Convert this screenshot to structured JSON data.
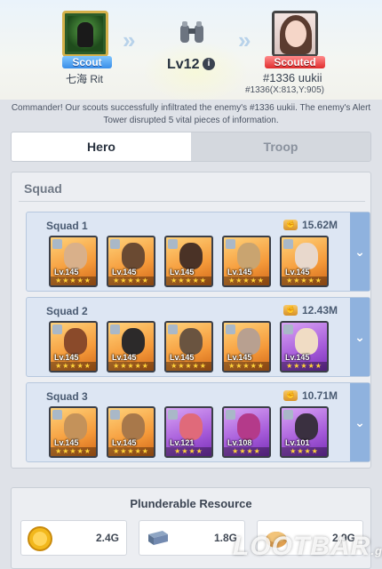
{
  "header": {
    "scout": {
      "role": "Scout",
      "name": "七海 Rit"
    },
    "level": "Lv12",
    "info_glyph": "i",
    "target": {
      "role": "Scouted",
      "name": "#1336 uukii",
      "coords": "#1336(X:813,Y:905)"
    }
  },
  "message": "Commander! Our scouts successfully infiltrated the enemy's #1336 uukii. The enemy's Alert Tower disrupted 5 vital pieces of information.",
  "tabs": [
    {
      "label": "Hero",
      "active": true
    },
    {
      "label": "Troop",
      "active": false
    }
  ],
  "squad_section": {
    "title": "Squad",
    "squads": [
      {
        "name": "Squad 1",
        "power": "15.62M",
        "heroes": [
          {
            "lv": "Lv.145",
            "rarity": "gold"
          },
          {
            "lv": "Lv.145",
            "rarity": "gold"
          },
          {
            "lv": "Lv.145",
            "rarity": "gold"
          },
          {
            "lv": "Lv.145",
            "rarity": "gold"
          },
          {
            "lv": "Lv.145",
            "rarity": "gold"
          }
        ]
      },
      {
        "name": "Squad 2",
        "power": "12.43M",
        "heroes": [
          {
            "lv": "Lv.145",
            "rarity": "gold"
          },
          {
            "lv": "Lv.145",
            "rarity": "gold"
          },
          {
            "lv": "Lv.145",
            "rarity": "gold"
          },
          {
            "lv": "Lv.145",
            "rarity": "gold"
          },
          {
            "lv": "Lv.145",
            "rarity": "purple"
          }
        ]
      },
      {
        "name": "Squad 3",
        "power": "10.71M",
        "heroes": [
          {
            "lv": "Lv.145",
            "rarity": "gold"
          },
          {
            "lv": "Lv.145",
            "rarity": "gold"
          },
          {
            "lv": "Lv.121",
            "rarity": "purple"
          },
          {
            "lv": "Lv.108",
            "rarity": "purple"
          },
          {
            "lv": "Lv.101",
            "rarity": "purple"
          }
        ]
      }
    ]
  },
  "resources": {
    "title": "Plunderable Resource",
    "items": [
      {
        "icon": "coin-icon",
        "value": "2.4G"
      },
      {
        "icon": "steel-icon",
        "value": "1.8G"
      },
      {
        "icon": "bread-icon",
        "value": "2.9G"
      }
    ]
  },
  "watermark": {
    "text": "LOOTBAR",
    "suffix": ".gg"
  },
  "colors": {
    "gold_card": "#f59a3a",
    "purple_card": "#a55ad9",
    "squad_card": "#dde6f3",
    "expand_bar": "#8fb2de"
  }
}
